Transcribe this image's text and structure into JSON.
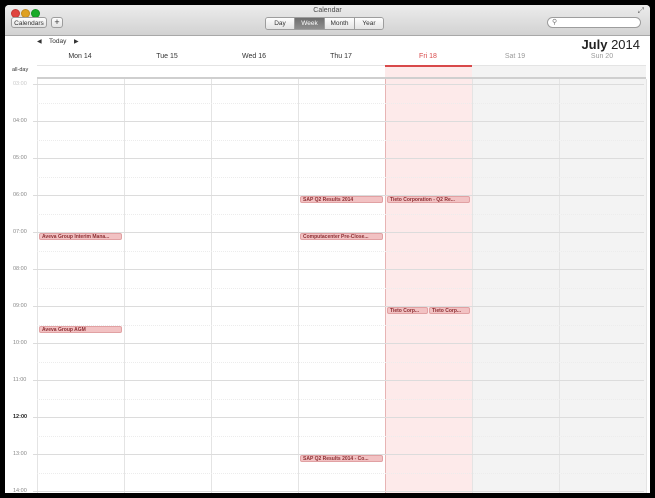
{
  "window": {
    "title": "Calendar"
  },
  "toolbar": {
    "calendars_label": "Calendars",
    "add_label": "+",
    "views": [
      {
        "label": "Day",
        "active": false
      },
      {
        "label": "Week",
        "active": true
      },
      {
        "label": "Month",
        "active": false
      },
      {
        "label": "Year",
        "active": false
      }
    ],
    "search": {
      "placeholder": ""
    }
  },
  "nav": {
    "prev": "◀",
    "today_label": "Today",
    "next": "▶"
  },
  "header": {
    "month": "July",
    "year": "2014"
  },
  "allday_label": "all-day",
  "days": [
    {
      "label": "Mon 14",
      "today": false,
      "weekend": false
    },
    {
      "label": "Tue 15",
      "today": false,
      "weekend": false
    },
    {
      "label": "Wed 16",
      "today": false,
      "weekend": false
    },
    {
      "label": "Thu 17",
      "today": false,
      "weekend": false
    },
    {
      "label": "Fri 18",
      "today": true,
      "weekend": false
    },
    {
      "label": "Sat 19",
      "today": false,
      "weekend": true
    },
    {
      "label": "Sun 20",
      "today": false,
      "weekend": true
    }
  ],
  "hours": [
    "03:00",
    "04:00",
    "05:00",
    "06:00",
    "07:00",
    "08:00",
    "09:00",
    "10:00",
    "11:00",
    "12:00",
    "13:00",
    "14:00"
  ],
  "events": [
    {
      "title": "SAP Q2 Results 2014",
      "day": 3,
      "start": "06:00"
    },
    {
      "title": "Tieto Corporation - Q2 Re...",
      "day": 4,
      "start": "06:00"
    },
    {
      "title": "Aveva Group Interim Mana...",
      "day": 0,
      "start": "07:00"
    },
    {
      "title": "Computacenter Pre-Close...",
      "day": 3,
      "start": "07:00"
    },
    {
      "title": "Tieto Corp...",
      "day": 4,
      "start": "09:00",
      "lane": 0,
      "lanes": 2
    },
    {
      "title": "Tieto Corp...",
      "day": 4,
      "start": "09:00",
      "lane": 1,
      "lanes": 2
    },
    {
      "title": "Aveva Group AGM",
      "day": 0,
      "start": "09:30"
    },
    {
      "title": "SAP Q2 Results 2014 - Co...",
      "day": 3,
      "start": "13:00"
    }
  ]
}
